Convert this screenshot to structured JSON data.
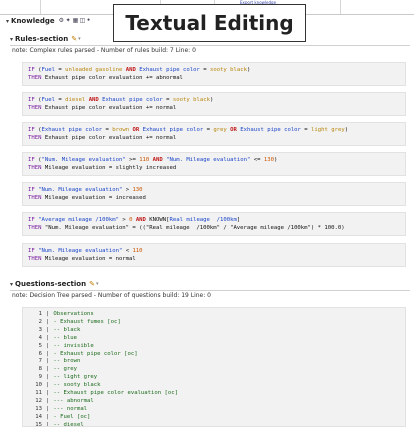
{
  "header": {
    "link_text": "Export knowledge",
    "knowledge_label": "Knowledge",
    "overlay_title": "Textual Editing"
  },
  "rules_section": {
    "title": "Rules-section",
    "note": "note: Complex rules parsed - Number of rules build: 7 Line: 0",
    "rules": [
      [
        [
          [
            "kw",
            "IF"
          ],
          [
            "pl",
            " ("
          ],
          [
            "vr",
            "Fuel"
          ],
          [
            "pl",
            " = "
          ],
          [
            "vl",
            "unleaded gasoline"
          ],
          [
            "pl",
            " "
          ],
          [
            "op",
            "AND"
          ],
          [
            "pl",
            " "
          ],
          [
            "vr",
            "Exhaust pipe color"
          ],
          [
            "pl",
            " = "
          ],
          [
            "vl",
            "sooty black"
          ],
          [
            "pl",
            ")"
          ]
        ],
        [
          [
            "kw",
            "THEN"
          ],
          [
            "pl",
            " Exhaust pipe color evaluation += abnormal"
          ]
        ]
      ],
      [
        [
          [
            "kw",
            "IF"
          ],
          [
            "pl",
            " ("
          ],
          [
            "vr",
            "Fuel"
          ],
          [
            "pl",
            " = "
          ],
          [
            "vl",
            "diesel"
          ],
          [
            "pl",
            " "
          ],
          [
            "op",
            "AND"
          ],
          [
            "pl",
            " "
          ],
          [
            "vr",
            "Exhaust pipe color"
          ],
          [
            "pl",
            " = "
          ],
          [
            "vl",
            "sooty black"
          ],
          [
            "pl",
            ")"
          ]
        ],
        [
          [
            "kw",
            "THEN"
          ],
          [
            "pl",
            " Exhaust pipe color evaluation += normal"
          ]
        ]
      ],
      [
        [
          [
            "kw",
            "IF"
          ],
          [
            "pl",
            " ("
          ],
          [
            "vr",
            "Exhaust pipe color"
          ],
          [
            "pl",
            " = "
          ],
          [
            "vl",
            "brown"
          ],
          [
            "pl",
            " "
          ],
          [
            "op",
            "OR"
          ],
          [
            "pl",
            " "
          ],
          [
            "vr",
            "Exhaust pipe color"
          ],
          [
            "pl",
            " = "
          ],
          [
            "vl",
            "grey"
          ],
          [
            "pl",
            " "
          ],
          [
            "op",
            "OR"
          ],
          [
            "pl",
            " "
          ],
          [
            "vr",
            "Exhaust pipe color"
          ],
          [
            "pl",
            " = "
          ],
          [
            "vl",
            "light grey"
          ],
          [
            "pl",
            ")"
          ]
        ],
        [
          [
            "kw",
            "THEN"
          ],
          [
            "pl",
            " Exhaust pipe color evaluation += normal"
          ]
        ]
      ],
      [
        [
          [
            "kw",
            "IF"
          ],
          [
            "pl",
            " ("
          ],
          [
            "vr",
            "\"Num. Mileage evaluation\""
          ],
          [
            "pl",
            " >= "
          ],
          [
            "num",
            "110"
          ],
          [
            "pl",
            " "
          ],
          [
            "op",
            "AND"
          ],
          [
            "pl",
            " "
          ],
          [
            "vr",
            "\"Num. Mileage evaluation\""
          ],
          [
            "pl",
            " <= "
          ],
          [
            "num",
            "130"
          ],
          [
            "pl",
            ")"
          ]
        ],
        [
          [
            "kw",
            "THEN"
          ],
          [
            "pl",
            " Mileage evaluation = slightly increased"
          ]
        ]
      ],
      [
        [
          [
            "kw",
            "IF"
          ],
          [
            "pl",
            " "
          ],
          [
            "vr",
            "\"Num. Mileage evaluation\""
          ],
          [
            "pl",
            " > "
          ],
          [
            "num",
            "130"
          ]
        ],
        [
          [
            "kw",
            "THEN"
          ],
          [
            "pl",
            " Mileage evaluation = increased"
          ]
        ]
      ],
      [
        [
          [
            "kw",
            "IF"
          ],
          [
            "pl",
            " "
          ],
          [
            "vr",
            "\"Average mileage /100km\""
          ],
          [
            "pl",
            " > "
          ],
          [
            "num",
            "0"
          ],
          [
            "pl",
            " "
          ],
          [
            "op",
            "AND"
          ],
          [
            "pl",
            " KNOWN["
          ],
          [
            "vr",
            "Real mileage  /100km"
          ],
          [
            "pl",
            "]"
          ]
        ],
        [
          [
            "kw",
            "THEN"
          ],
          [
            "pl",
            " \"Num. Mileage evaluation\" = ((\"Real mileage  /100km\" / \"Average mileage /100km\") * 100.0)"
          ]
        ]
      ],
      [
        [
          [
            "kw",
            "IF"
          ],
          [
            "pl",
            " "
          ],
          [
            "vr",
            "\"Num. Mileage evaluation\""
          ],
          [
            "pl",
            " < "
          ],
          [
            "num",
            "110"
          ]
        ],
        [
          [
            "kw",
            "THEN"
          ],
          [
            "pl",
            " Mileage evaluation = normal"
          ]
        ]
      ]
    ]
  },
  "questions_section": {
    "title": "Questions-section",
    "note": "note: Decision Tree parsed - Number of questions build: 19 Line: 0",
    "lines": [
      {
        "n": "1",
        "t": "Observations"
      },
      {
        "n": "2",
        "t": "- Exhaust fumes [oc]"
      },
      {
        "n": "3",
        "t": "-- black"
      },
      {
        "n": "4",
        "t": "-- blue"
      },
      {
        "n": "5",
        "t": "-- invisible"
      },
      {
        "n": "6",
        "t": "- Exhaust pipe color [oc]"
      },
      {
        "n": "7",
        "t": "-- brown"
      },
      {
        "n": "8",
        "t": "-- grey"
      },
      {
        "n": "9",
        "t": "-- light grey"
      },
      {
        "n": "10",
        "t": "-- sooty black"
      },
      {
        "n": "11",
        "t": "-- Exhaust pipe color evaluation [oc]"
      },
      {
        "n": "12",
        "t": "--- abnormal"
      },
      {
        "n": "13",
        "t": "--- normal"
      },
      {
        "n": "14",
        "t": "- Fuel [oc]"
      },
      {
        "n": "15",
        "t": "-- diesel"
      }
    ]
  },
  "colors": {
    "keyword": "#7a1fa2",
    "operator": "#c01818",
    "variable": "#1a44c8",
    "value": "#b8860b",
    "number": "#cc5500",
    "tree_text": "#1a6a1a"
  },
  "icons": [
    "collapse-triangle-icon",
    "pencil-edit-icon",
    "settings-icon"
  ]
}
